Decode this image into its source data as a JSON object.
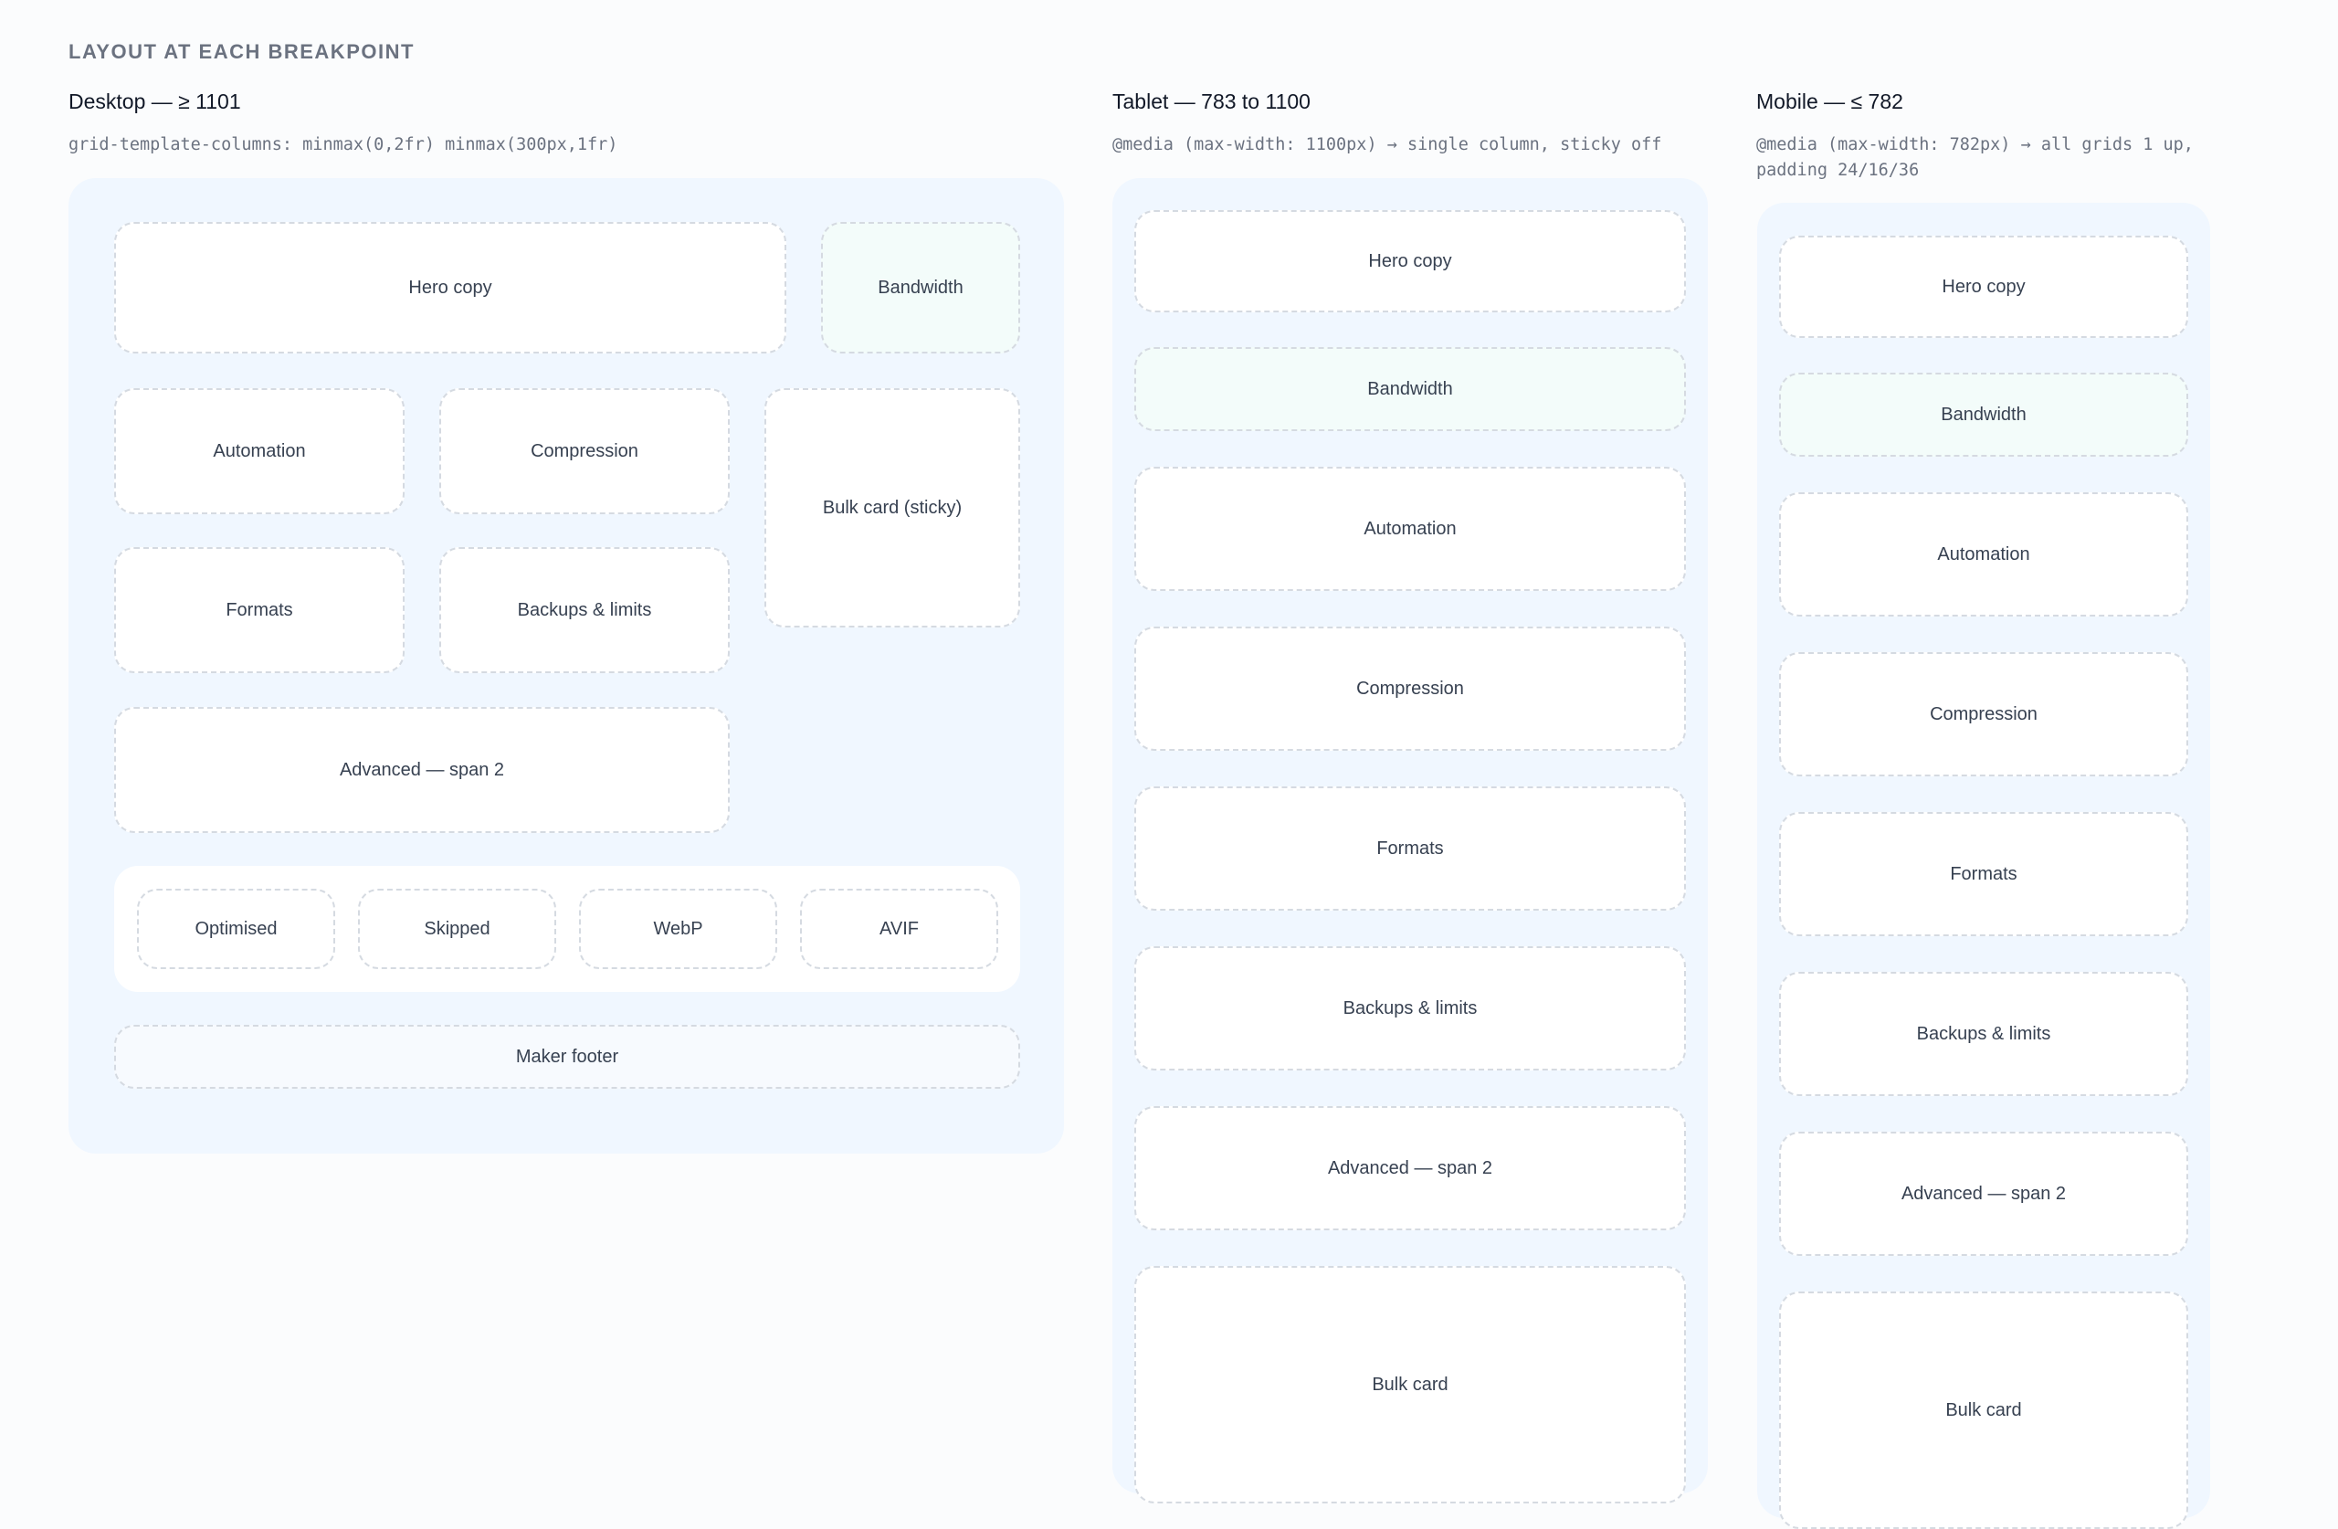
{
  "section_title": "LAYOUT AT EACH BREAKPOINT",
  "desktop": {
    "title": "Desktop — ≥ 1101",
    "code": "grid-template-columns: minmax(0,2fr) minmax(300px,1fr)",
    "hero": "Hero copy",
    "bandwidth": "Bandwidth",
    "automation": "Automation",
    "compression": "Compression",
    "bulk": "Bulk card (sticky)",
    "formats": "Formats",
    "backups": "Backups & limits",
    "advanced": "Advanced — span 2",
    "stats": [
      "Optimised",
      "Skipped",
      "WebP",
      "AVIF"
    ],
    "footer": "Maker footer"
  },
  "tablet": {
    "title": "Tablet — 783 to 1100",
    "code": "@media (max-width: 1100px) → single column, sticky off",
    "items": [
      "Hero copy",
      "Bandwidth",
      "Automation",
      "Compression",
      "Formats",
      "Backups & limits",
      "Advanced — span 2",
      "Bulk card"
    ]
  },
  "mobile": {
    "title": "Mobile — ≤ 782",
    "code": "@media (max-width: 782px) → all grids 1 up,\npadding 24/16/36",
    "items": [
      "Hero copy",
      "Bandwidth",
      "Automation",
      "Compression",
      "Formats",
      "Backups & limits",
      "Advanced — span 2",
      "Bulk card"
    ]
  },
  "colors": {
    "panel_bg": "#f0f7ff",
    "box_border": "#d5dae1",
    "bandwidth_bg": "#f3fcfa"
  }
}
